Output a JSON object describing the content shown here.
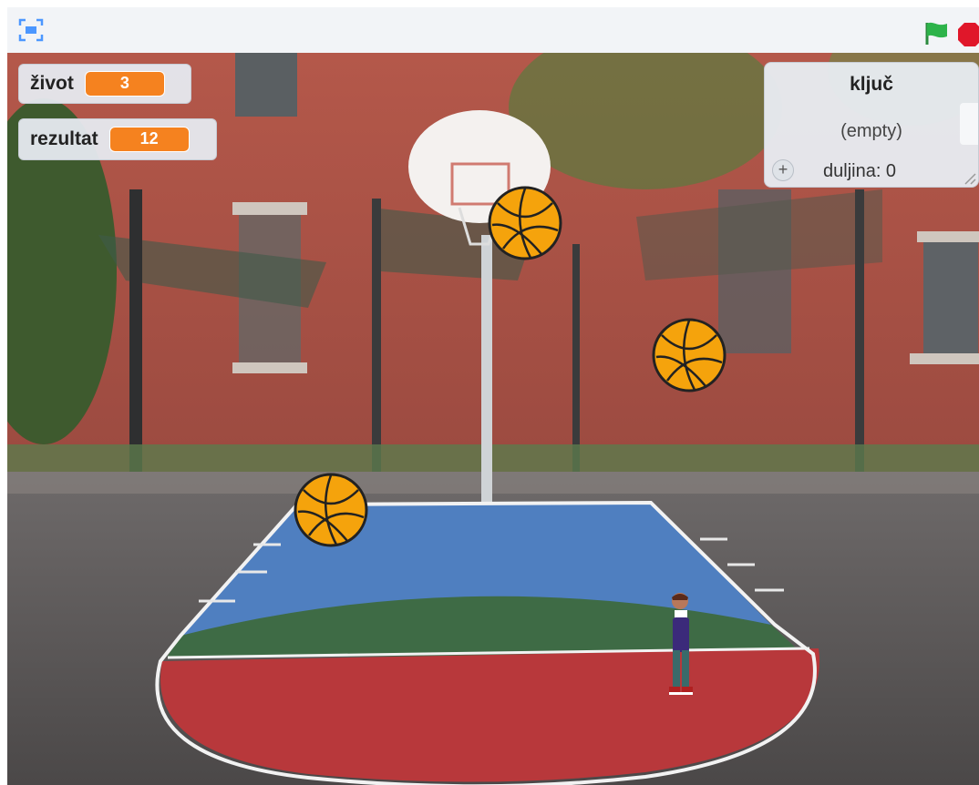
{
  "toolbar": {
    "fullscreen_icon": "fullscreen-icon",
    "green_flag_icon": "green-flag-icon",
    "stop_icon": "stop-sign-icon",
    "colors": {
      "flag": "#2db34a",
      "stop": "#e0172a"
    }
  },
  "variables": [
    {
      "label": "život",
      "value": "3"
    },
    {
      "label": "rezultat",
      "value": "12"
    }
  ],
  "list_monitor": {
    "title": "ključ",
    "empty_text": "(empty)",
    "length_text": "duljina: 0",
    "add_icon": "plus-icon"
  },
  "sprites": {
    "balls": [
      "basketball",
      "basketball",
      "basketball"
    ],
    "player": "player-sprite"
  },
  "colors": {
    "monitor_value": "#f5821f",
    "court_blue": "#4f7fc0",
    "court_green": "#3e6b45",
    "court_red": "#b8383b",
    "ball": "#f5a30c"
  }
}
